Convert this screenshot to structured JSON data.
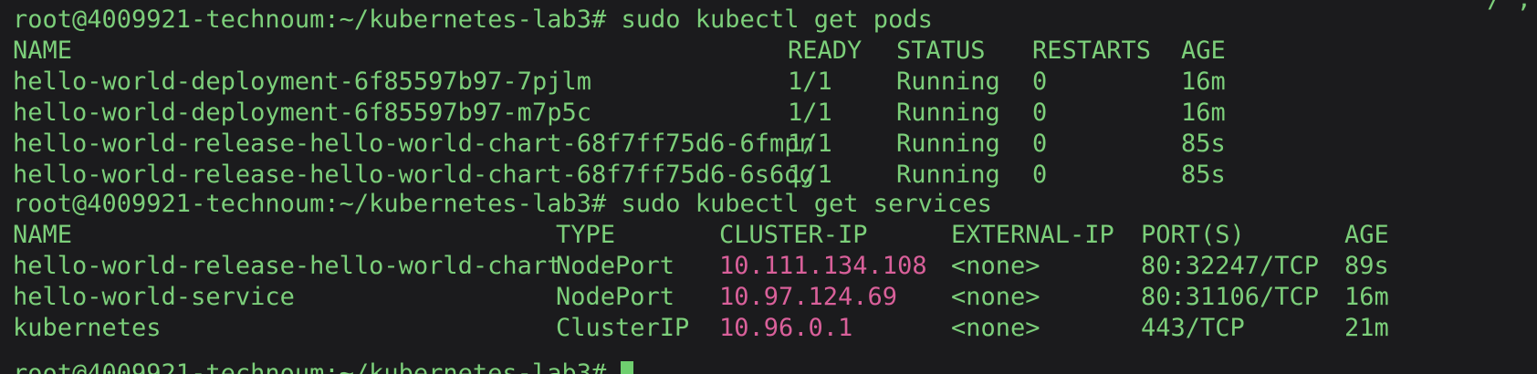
{
  "terminal": {
    "top_fragment": "/ ,",
    "prompt1": "root@4009921-technoum:~/kubernetes-lab3# sudo kubectl get pods",
    "pods": {
      "headers": [
        "NAME",
        "READY",
        "STATUS",
        "RESTARTS",
        "AGE"
      ],
      "rows": [
        [
          "hello-world-deployment-6f85597b97-7pjlm",
          "1/1",
          "Running",
          "0",
          "16m"
        ],
        [
          "hello-world-deployment-6f85597b97-m7p5c",
          "1/1",
          "Running",
          "0",
          "16m"
        ],
        [
          "hello-world-release-hello-world-chart-68f7ff75d6-6fmpn",
          "1/1",
          "Running",
          "0",
          "85s"
        ],
        [
          "hello-world-release-hello-world-chart-68f7ff75d6-6s6qg",
          "1/1",
          "Running",
          "0",
          "85s"
        ]
      ]
    },
    "prompt2": "root@4009921-technoum:~/kubernetes-lab3# sudo kubectl get services",
    "services": {
      "headers": [
        "NAME",
        "TYPE",
        "CLUSTER-IP",
        "EXTERNAL-IP",
        "PORT(S)",
        "AGE"
      ],
      "rows": [
        [
          "hello-world-release-hello-world-chart",
          "NodePort",
          "10.111.134.108",
          "<none>",
          "80:32247/TCP",
          "89s"
        ],
        [
          "hello-world-service",
          "NodePort",
          "10.97.124.69",
          "<none>",
          "80:31106/TCP",
          "16m"
        ],
        [
          "kubernetes",
          "ClusterIP",
          "10.96.0.1",
          "<none>",
          "443/TCP",
          "21m"
        ]
      ]
    },
    "prompt3_partial": "root@4009921-technoum:~/kubernetes-lab3# ",
    "colors": {
      "background": "#1b1b1d",
      "text": "#7ccf7a",
      "ip": "#d9609a",
      "cursor": "#6fcf6f"
    }
  }
}
